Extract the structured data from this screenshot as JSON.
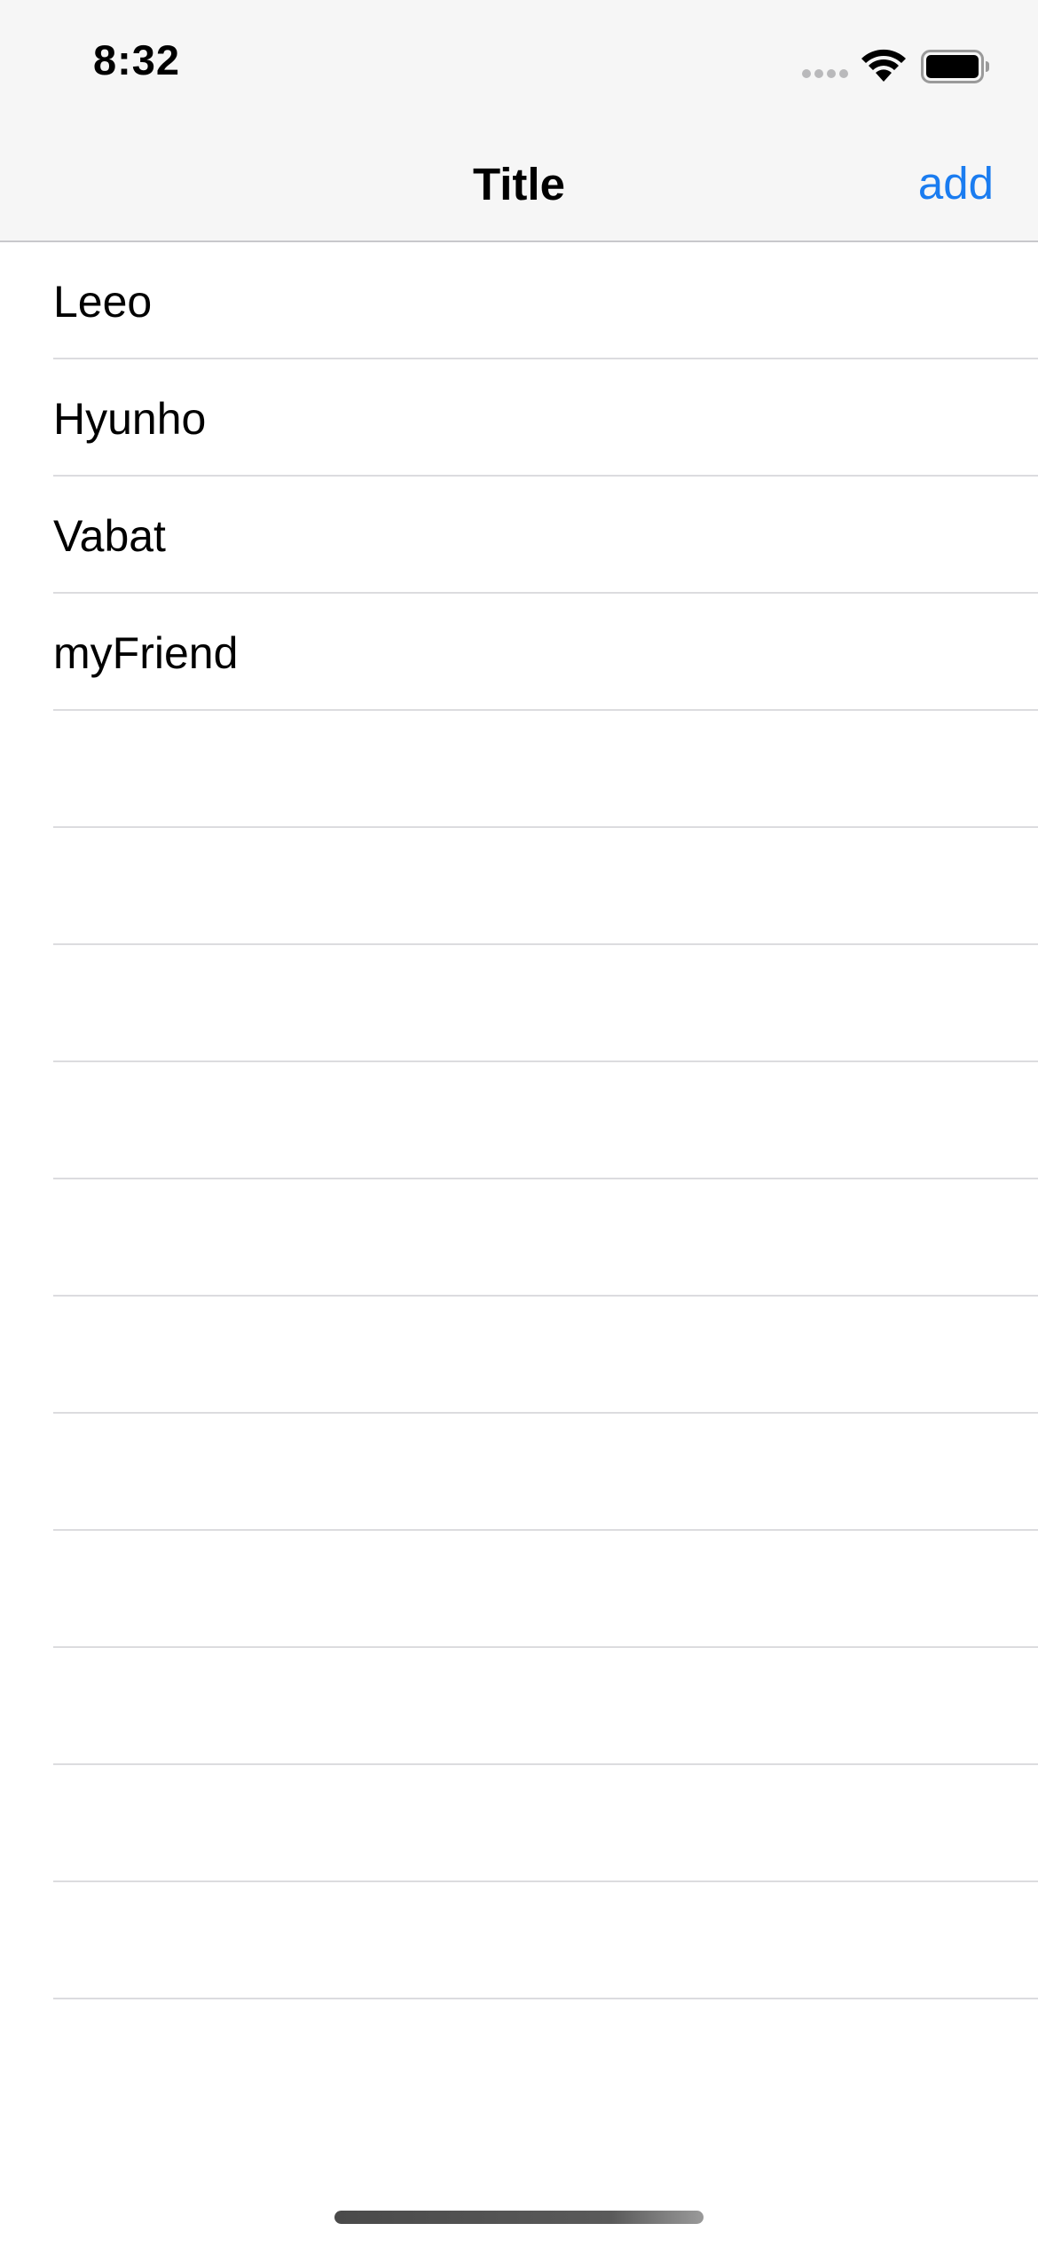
{
  "status_bar": {
    "time": "8:32",
    "icons": [
      "signal-icon",
      "wifi-icon",
      "battery-icon"
    ]
  },
  "nav_bar": {
    "title": "Title",
    "add_label": "add",
    "accent_color": "#1a7cf0"
  },
  "table": {
    "rows": [
      {
        "label": "Leeo"
      },
      {
        "label": "Hyunho"
      },
      {
        "label": "Vabat"
      },
      {
        "label": "myFriend"
      },
      {
        "label": ""
      },
      {
        "label": ""
      },
      {
        "label": ""
      },
      {
        "label": ""
      },
      {
        "label": ""
      },
      {
        "label": ""
      },
      {
        "label": ""
      },
      {
        "label": ""
      },
      {
        "label": ""
      },
      {
        "label": ""
      },
      {
        "label": ""
      }
    ]
  }
}
